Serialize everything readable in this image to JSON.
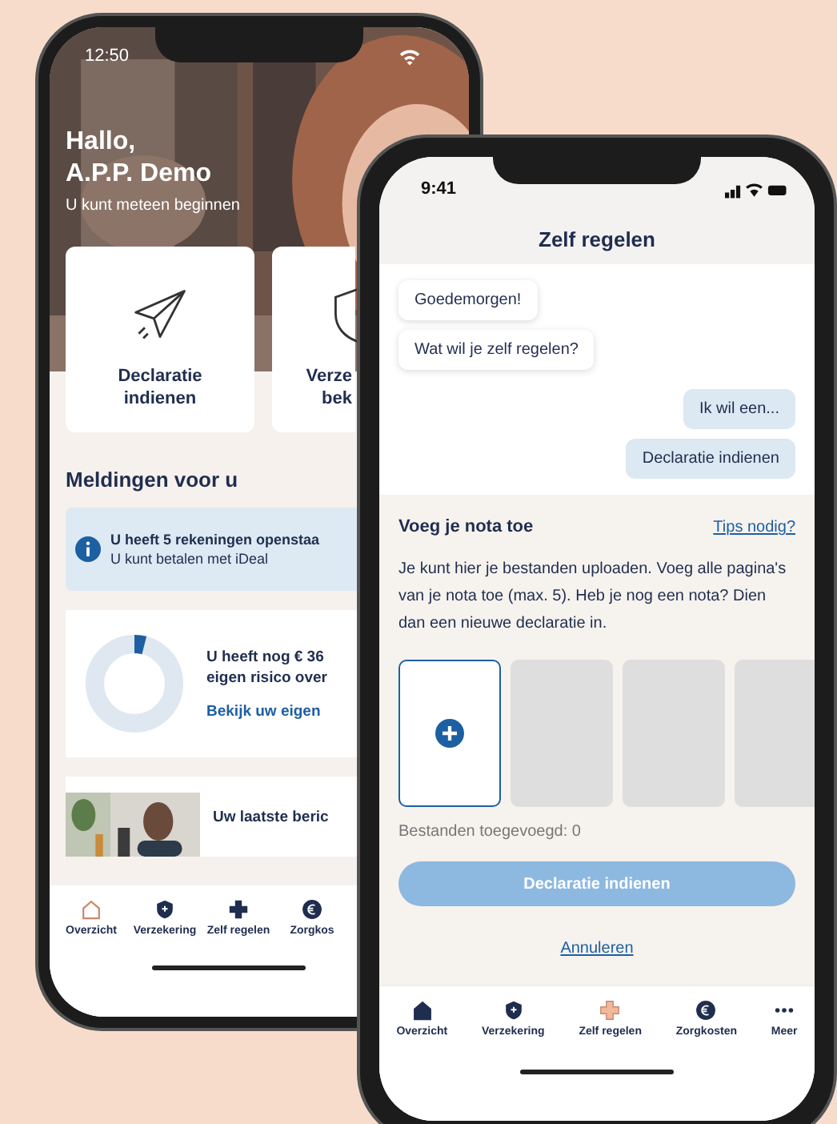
{
  "home_screen": {
    "status_time": "12:50",
    "greeting": "Hallo,",
    "name": "A.P.P. Demo",
    "subtitle": "U kunt meteen beginnen",
    "tiles": [
      {
        "kind": "plane",
        "label_lines": [
          "Declaratie",
          "indienen"
        ]
      },
      {
        "kind": "shield",
        "label_lines": [
          "Verze",
          "bek"
        ]
      }
    ],
    "notifications_heading": "Meldingen voor u",
    "alert": {
      "title": "U heeft 5 rekeningen openstaa",
      "text": "U kunt betalen met iDeal"
    },
    "deductible_card": {
      "level": 0.04,
      "lines": [
        "U heeft nog € 36",
        "eigen risico over"
      ],
      "link": "Bekijk uw eigen"
    },
    "message_card": {
      "title": "Uw laatste beric"
    },
    "nav": [
      {
        "label": "Overzicht",
        "kind": "home",
        "selected": true
      },
      {
        "label": "Verzekering",
        "kind": "shield",
        "selected": false
      },
      {
        "label": "Zelf regelen",
        "kind": "cross",
        "selected": false
      },
      {
        "label": "Zorgkos",
        "kind": "euro",
        "selected": false
      }
    ]
  },
  "zelf_regelen_screen": {
    "status_time": "9:41",
    "title": "Zelf regelen",
    "messages": [
      {
        "text": "Goedemorgen!",
        "kind": "bot"
      },
      {
        "text": "Wat wil je zelf regelen?",
        "kind": "bot"
      },
      {
        "text": "Ik wil een...",
        "kind": "user"
      },
      {
        "text": "Declaratie indienen",
        "kind": "user"
      }
    ],
    "upload": {
      "heading": "Voeg je nota toe",
      "tips_link": "Tips nodig?",
      "description": "Je kunt hier je bestanden uploaden. Voeg alle pagina's van je nota toe (max. 5). Heb je nog een nota? Dien dan een nieuwe declaratie in.",
      "slots": [
        {
          "kind": "add"
        },
        {
          "kind": "empty"
        },
        {
          "kind": "empty"
        },
        {
          "kind": "empty"
        }
      ],
      "count": "Bestanden toegevoegd: 0",
      "submit": {
        "label": "Declaratie indienen",
        "disabled": true
      },
      "cancel": "Annuleren"
    },
    "nav": [
      {
        "label": "Overzicht",
        "kind": "home",
        "selected": false
      },
      {
        "label": "Verzekering",
        "kind": "shield",
        "selected": false
      },
      {
        "label": "Zelf regelen",
        "kind": "cross",
        "selected": true
      },
      {
        "label": "Zorgkosten",
        "kind": "euro",
        "selected": false
      },
      {
        "label": "Meer",
        "kind": "dots",
        "selected": false
      }
    ]
  }
}
